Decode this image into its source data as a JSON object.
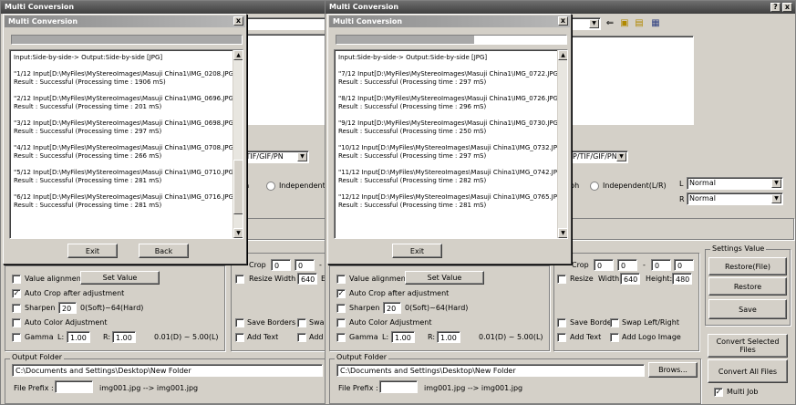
{
  "left": {
    "title": "Multi Conversion",
    "close_btn": "x",
    "dialog": {
      "title": "Multi Conversion",
      "close_btn": "x",
      "progress": 1.0,
      "header": "Input:Side-by-side-> Output:Side-by-side [JPG]",
      "entries": [
        {
          "line1": "\"1/12 Input[D:\\MyFiles\\MyStereoImages\\Masuji China1\\IMG_0208.JPG",
          "line2": "Result : Successful (Processing time : 1906 mS)"
        },
        {
          "line1": "\"2/12 Input[D:\\MyFiles\\MyStereoImages\\Masuji China1\\IMG_0696.JPG",
          "line2": "Result : Successful (Processing time : 201 mS)"
        },
        {
          "line1": "\"3/12 Input[D:\\MyFiles\\MyStereoImages\\Masuji China1\\IMG_0698.JPG",
          "line2": "Result : Successful (Processing time : 297 mS)"
        },
        {
          "line1": "\"4/12 Input[D:\\MyFiles\\MyStereoImages\\Masuji China1\\IMG_0708.JPG",
          "line2": "Result : Successful (Processing time : 266 mS)"
        },
        {
          "line1": "\"5/12 Input[D:\\MyFiles\\MyStereoImages\\Masuji China1\\IMG_0710.JPG",
          "line2": "Result : Successful (Processing time : 281 mS)"
        },
        {
          "line1": "\"6/12 Input[D:\\MyFiles\\MyStereoImages\\Masuji China1\\IMG_0716.JPG",
          "line2": "Result : Successful (Processing time : 281 mS)"
        }
      ],
      "exit_label": "Exit",
      "back_label": "Back"
    },
    "format_partial": "P/TIF/GIF/PN",
    "radio1_label": "ph",
    "radio2_label": "Independent(L/R",
    "crop_label": "Crop",
    "crop_val1": "0",
    "crop_val2": "0",
    "crop_dash": "-",
    "resize_label": "Resize",
    "width_label": "Width",
    "width_val": "640",
    "height_partial": "E",
    "value_alignment": "Value alignment",
    "set_value": "Set Value",
    "auto_crop": "Auto Crop after adjustment",
    "sharpen": "Sharpen",
    "sharpen_val": "20",
    "sharpen_range": "0(Soft)~64(Hard)",
    "auto_color": "Auto Color Adjustment",
    "gamma": "Gamma",
    "gamma_l_label": "L:",
    "gamma_l": "1.00",
    "gamma_r_label": "R:",
    "gamma_r": "1.00",
    "gamma_range": "0.01(D) ~ 5.00(L)",
    "save_borders": "Save Borders",
    "swap_partial": "Swa",
    "add_text": "Add Text",
    "add_partial": "Add",
    "output_folder": "Output Folder",
    "folder_path": "C:\\Documents and Settings\\Desktop\\New Folder",
    "file_prefix": "File Prefix :",
    "prefix_example": "img001.jpg --> img001.jpg"
  },
  "right": {
    "title": "Multi Conversion",
    "help_btn": "?",
    "close_btn": "x",
    "dialog": {
      "title": "Multi Conversion",
      "close_btn": "x",
      "progress": 0.6,
      "header": "Input:Side-by-side-> Output:Side-by-side [JPG]",
      "entries": [
        {
          "line1": "\"7/12 Input[D:\\MyFiles\\MyStereoImages\\Masuji China1\\IMG_0722.JPG",
          "line2": "Result : Successful (Processing time : 297 mS)"
        },
        {
          "line1": "\"8/12 Input[D:\\MyFiles\\MyStereoImages\\Masuji China1\\IMG_0726.JPG",
          "line2": "Result : Successful (Processing time : 296 mS)"
        },
        {
          "line1": "\"9/12 Input[D:\\MyFiles\\MyStereoImages\\Masuji China1\\IMG_0730.JPG",
          "line2": "Result : Successful (Processing time : 250 mS)"
        },
        {
          "line1": "\"10/12 Input[D:\\MyFiles\\MyStereoImages\\Masuji China1\\IMG_0732.JPG",
          "line2": "Result : Successful (Processing time : 297 mS)"
        },
        {
          "line1": "\"11/12 Input[D:\\MyFiles\\MyStereoImages\\Masuji China1\\IMG_0742.JPG",
          "line2": "Result : Successful (Processing time : 282 mS)"
        },
        {
          "line1": "\"12/12 Input[D:\\MyFiles\\MyStereoImages\\Masuji China1\\IMG_0765.JPG",
          "line2": "Result : Successful (Processing time : 281 mS)"
        }
      ],
      "exit_label": "Exit"
    },
    "format_partial": "P/TIF/GIF/PN",
    "radio1_label": "ph",
    "radio2_label": "Independent(L/R)",
    "l_label": "L",
    "l_select": "Normal",
    "r_label": "R",
    "r_select": "Normal",
    "crop_label": "Crop",
    "crop_val1": "0",
    "crop_val2": "0",
    "crop_dash": "-",
    "crop_val3": "0",
    "crop_val4": "0",
    "resize_label": "Resize",
    "width_label": "Width",
    "width_val": "640",
    "height_label": "Height:",
    "height_val": "480",
    "value_alignment": "Value alignment",
    "set_value": "Set Value",
    "auto_crop": "Auto Crop after adjustment",
    "sharpen": "Sharpen",
    "sharpen_val": "20",
    "sharpen_range": "0(Soft)~64(Hard)",
    "auto_color": "Auto Color Adjustment",
    "gamma": "Gamma",
    "gamma_l_label": "L:",
    "gamma_l": "1.00",
    "gamma_r_label": "R:",
    "gamma_r": "1.00",
    "gamma_range": "0.01(D) ~ 5.00(L)",
    "save_borders": "Save Borders",
    "swap": "Swap Left/Right",
    "add_text": "Add Text",
    "add_logo": "Add Logo Image",
    "output_folder": "Output Folder",
    "folder_path": "C:\\Documents and Settings\\Desktop\\New Folder",
    "browse": "Brows...",
    "file_prefix": "File Prefix :",
    "prefix_example": "img001.jpg --> img001.jpg",
    "settings_value": "Settings Value",
    "restore_file": "Restore(File)",
    "restore": "Restore",
    "save": "Save",
    "convert_selected": "Convert Selected Files",
    "convert_all": "Convert All Files",
    "multi_job": "Multi Job"
  }
}
